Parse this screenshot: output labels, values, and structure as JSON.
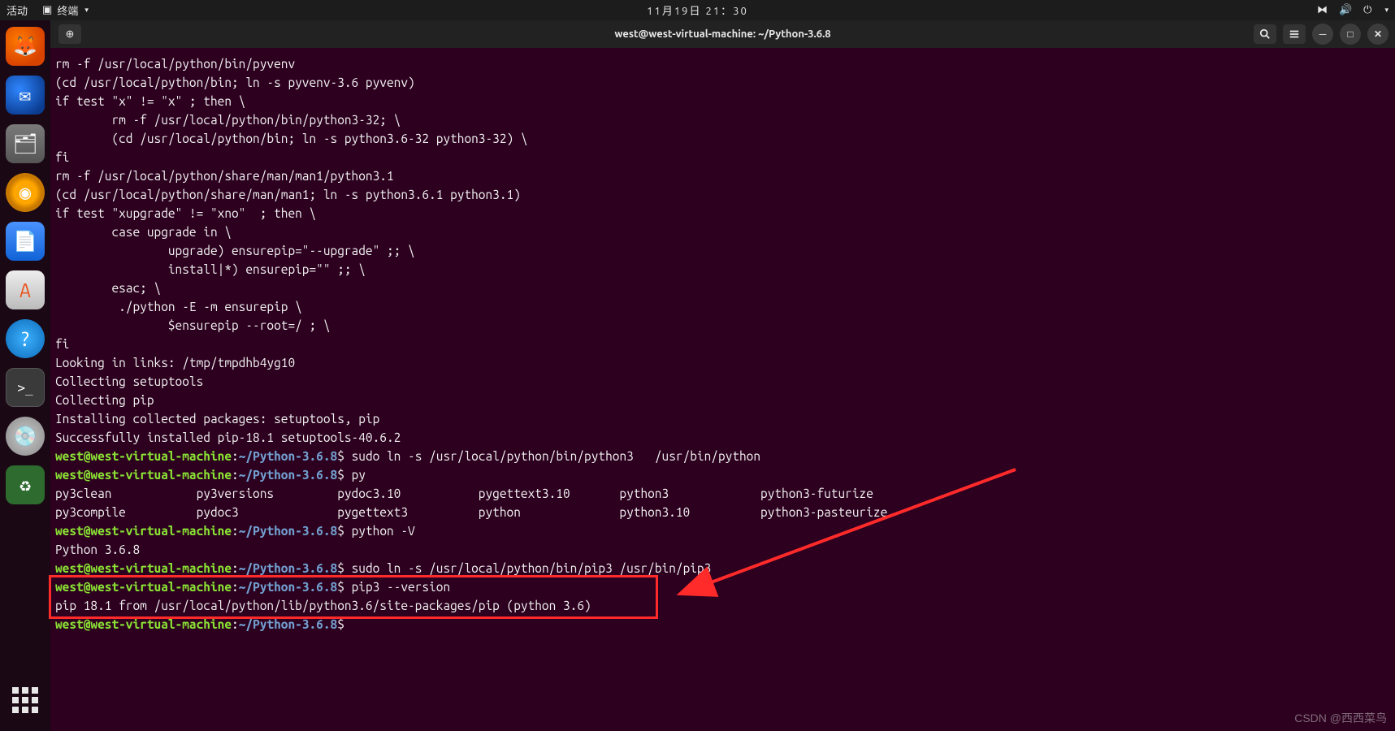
{
  "panel": {
    "activities": "活动",
    "app_name": "终端",
    "clock": "11月19日 21：30"
  },
  "window": {
    "title": "west@west-virtual-machine: ~/Python-3.6.8",
    "newtab_glyph": "⊕"
  },
  "prompt": {
    "user": "west@west-virtual-machine",
    "path": "~/Python-3.6.8",
    "sep": ":",
    "sym": "$"
  },
  "lines": [
    "rm -f /usr/local/python/bin/pyvenv",
    "(cd /usr/local/python/bin; ln -s pyvenv-3.6 pyvenv)",
    "if test \"x\" != \"x\" ; then \\",
    "        rm -f /usr/local/python/bin/python3-32; \\",
    "        (cd /usr/local/python/bin; ln -s python3.6-32 python3-32) \\",
    "fi",
    "rm -f /usr/local/python/share/man/man1/python3.1",
    "(cd /usr/local/python/share/man/man1; ln -s python3.6.1 python3.1)",
    "if test \"xupgrade\" != \"xno\"  ; then \\",
    "        case upgrade in \\",
    "                upgrade) ensurepip=\"--upgrade\" ;; \\",
    "                install|*) ensurepip=\"\" ;; \\",
    "        esac; \\",
    "         ./python -E -m ensurepip \\",
    "                $ensurepip --root=/ ; \\",
    "fi",
    "Looking in links: /tmp/tmpdhb4yg10",
    "Collecting setuptools",
    "Collecting pip",
    "Installing collected packages: setuptools, pip",
    "Successfully installed pip-18.1 setuptools-40.6.2"
  ],
  "cmd1": " sudo ln -s /usr/local/python/bin/python3   /usr/bin/python",
  "cmd2": " py",
  "cols": "py3clean            py3versions         pydoc3.10           pygettext3.10       python3             python3-futurize\npy3compile          pydoc3              pygettext3          python              python3.10          python3-pasteurize",
  "cmd3": " python -V",
  "out3": "Python 3.6.8",
  "cmd4": " sudo ln -s /usr/local/python/bin/pip3 /usr/bin/pip3",
  "cmd5": " pip3 --version",
  "out5": "pip 18.1 from /usr/local/python/lib/python3.6/site-packages/pip (python 3.6)",
  "watermark": "CSDN @西西菜鸟"
}
